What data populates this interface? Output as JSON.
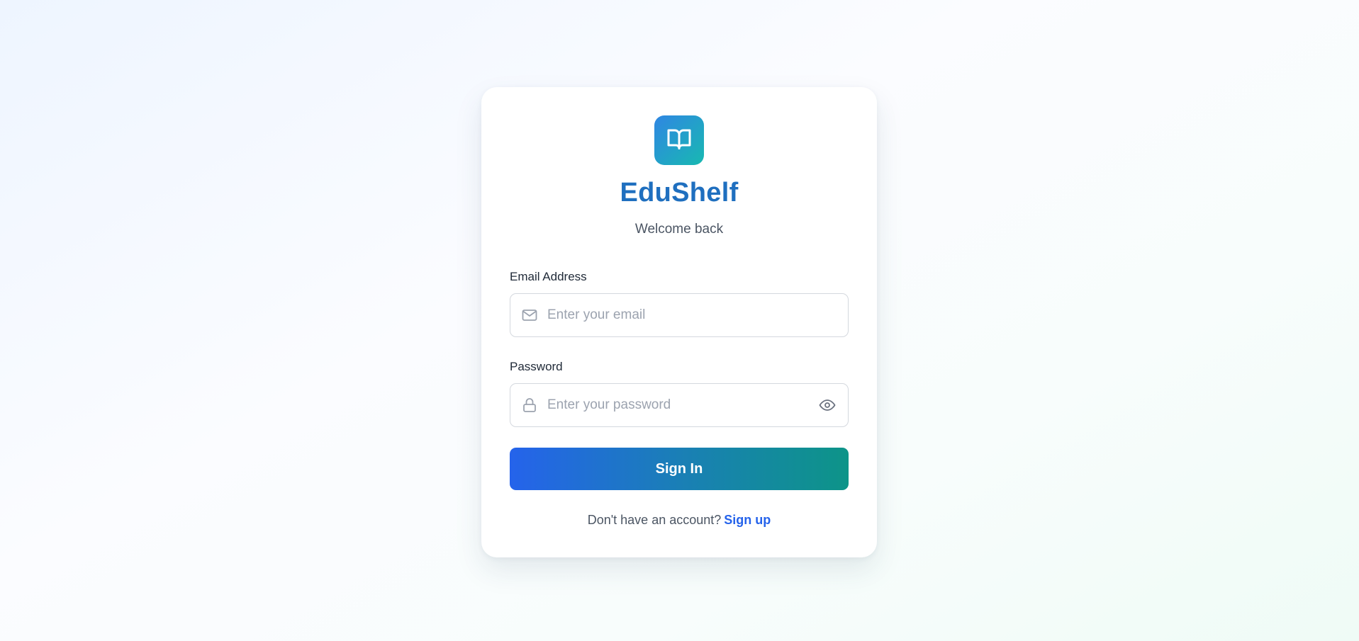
{
  "brand": {
    "name": "EduShelf",
    "subtitle": "Welcome back",
    "logo_icon": "book-open-icon"
  },
  "form": {
    "email": {
      "label": "Email Address",
      "placeholder": "Enter your email",
      "value": "",
      "icon": "mail-icon"
    },
    "password": {
      "label": "Password",
      "placeholder": "Enter your password",
      "value": "",
      "icon": "lock-icon",
      "toggle_icon": "eye-icon"
    },
    "submit_label": "Sign In"
  },
  "footer": {
    "prompt": "Don't have an account?",
    "link_label": "Sign up"
  },
  "colors": {
    "brand_text": "#1f6fbf",
    "logo_gradient": [
      "#2f86e3",
      "#18b9b1"
    ],
    "button_gradient": [
      "#2563eb",
      "#0d9488"
    ],
    "link": "#2563eb",
    "placeholder": "#9ca3af"
  }
}
